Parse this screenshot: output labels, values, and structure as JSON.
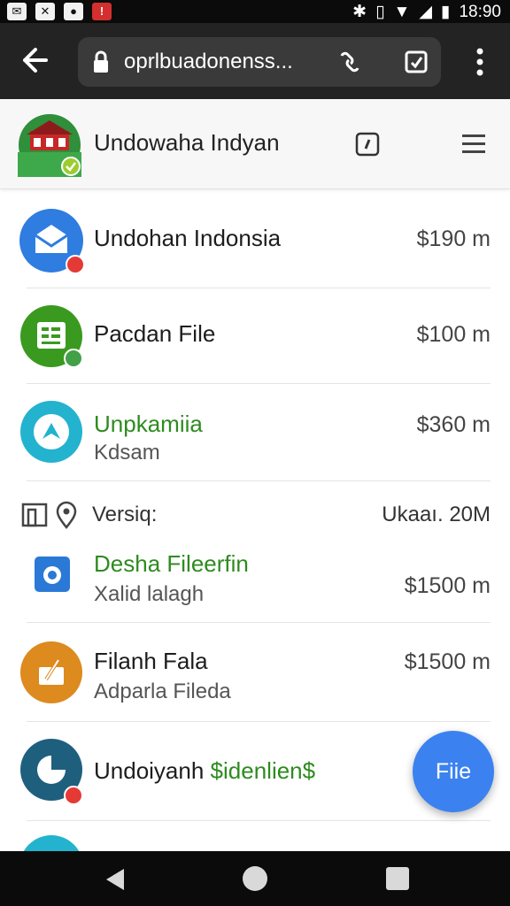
{
  "status_bar": {
    "time": "18:90",
    "left_icons": [
      "notification-icon",
      "mail-icon",
      "game-icon",
      "app-alert-icon"
    ],
    "right_icons": [
      "bluetooth-icon",
      "vibrate-icon",
      "wifi-icon",
      "signal-icon",
      "battery-icon"
    ]
  },
  "browser": {
    "url": "oprlbuadonenss...",
    "icons": [
      "back-arrow-icon",
      "lock-icon",
      "link-icon",
      "check-box-icon",
      "more-vert-icon"
    ]
  },
  "app_header": {
    "title": "Undowaha Indyan",
    "icons": [
      "app-logo-icon",
      "compass-icon",
      "hamburger-icon"
    ]
  },
  "items": [
    {
      "title": "Undohan Indonsia",
      "subtitle": "",
      "price": "$190 m",
      "icon": "mail-icon",
      "badge": "red"
    },
    {
      "title": "Pacdan File",
      "subtitle": "",
      "price": "$100 m",
      "icon": "spreadsheet-icon",
      "badge": "green"
    },
    {
      "title": "Unpkamiia",
      "subtitle": "Kdsam",
      "price": "$360 m",
      "icon": "navigation-icon",
      "badge": ""
    },
    {
      "title": "Desha Fileerfin",
      "subtitle": "Xalid lalagh",
      "price": "$1500 m",
      "icon": "camera-icon",
      "badge": ""
    },
    {
      "title": "Filanh Fala",
      "subtitle": "Adparla Fileda",
      "price": "$1500 m",
      "icon": "edit-icon",
      "badge": ""
    },
    {
      "title": "Undoiyanh",
      "title_green": "$idenlien$",
      "subtitle": "",
      "price": "",
      "icon": "clock-icon",
      "badge": "red"
    }
  ],
  "version_row": {
    "label": "Versiq:",
    "value": "Ukaaı. 20M"
  },
  "fab": {
    "label": "Fiie"
  },
  "colors": {
    "accent_blue": "#3b82f0",
    "green_text": "#2e8b1f",
    "dark_bar": "#232323"
  }
}
